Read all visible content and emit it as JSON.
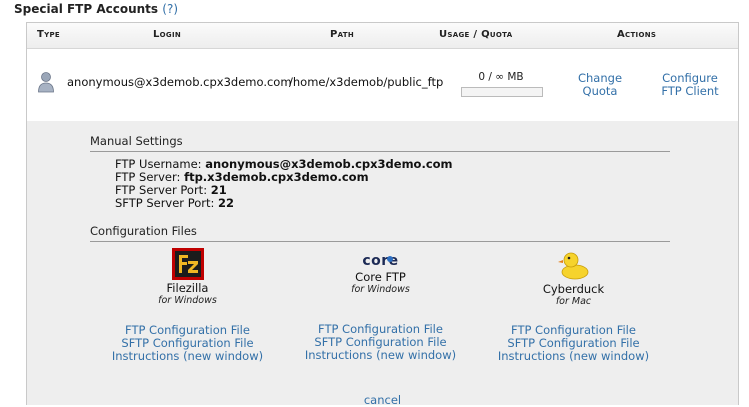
{
  "heading": {
    "title": "Special FTP Accounts",
    "help": "(?)"
  },
  "table": {
    "headers": {
      "type": "Type",
      "login": "Login",
      "path": "Path",
      "usage": "Usage / Quota",
      "actions": "Actions"
    },
    "row": {
      "login": "anonymous@x3demob.cpx3demo.com",
      "path": "/home/x3demob/public_ftp",
      "usage": "0 / ∞ MB",
      "usage_fraction": 0,
      "change_quota": [
        "Change",
        "Quota"
      ],
      "configure": [
        "Configure",
        "FTP Client"
      ]
    }
  },
  "manual": {
    "title": "Manual Settings",
    "username_label": "FTP Username:",
    "username": "anonymous@x3demob.cpx3demo.com",
    "server_label": "FTP Server:",
    "server": "ftp.x3demob.cpx3demo.com",
    "port_label": "FTP Server Port:",
    "port": "21",
    "sftp_port_label": "SFTP Server Port:",
    "sftp_port": "22"
  },
  "config_files": {
    "title": "Configuration Files",
    "clients": [
      {
        "name": "Filezilla",
        "os": "for Windows",
        "ftp": "FTP Configuration File",
        "sftp": "SFTP Configuration File",
        "instr": "Instructions (new window)"
      },
      {
        "name": "Core FTP",
        "logo_text": "core",
        "os": "for Windows",
        "ftp": "FTP Configuration File",
        "sftp": "SFTP Configuration File",
        "instr": "Instructions (new window)"
      },
      {
        "name": "Cyberduck",
        "os": "for Mac",
        "ftp": "FTP Configuration File",
        "sftp": "SFTP Configuration File",
        "instr": "Instructions (new window)"
      }
    ]
  },
  "cancel": "cancel",
  "colors": {
    "link": "#3370a8",
    "details_bg": "#eeeeee"
  }
}
